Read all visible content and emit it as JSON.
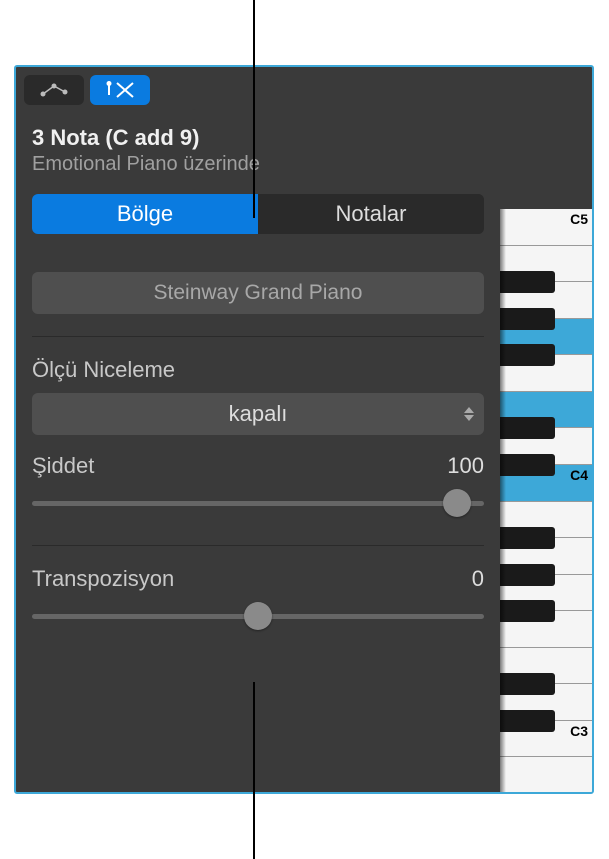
{
  "header": {
    "title": "3 Nota (C add 9)",
    "subtitle": "Emotional Piano üzerinde"
  },
  "tabs": {
    "region": "Bölge",
    "notes": "Notalar"
  },
  "region_name": "Steinway Grand Piano",
  "quantize": {
    "label": "Ölçü Niceleme",
    "value": "kapalı"
  },
  "velocity": {
    "label": "Şiddet",
    "value": "100",
    "position": 94
  },
  "transpose": {
    "label": "Transpozisyon",
    "value": "0",
    "position": 50
  },
  "keyboard": {
    "labels": {
      "c5": "C5",
      "c4": "C4",
      "c3": "C3"
    }
  }
}
